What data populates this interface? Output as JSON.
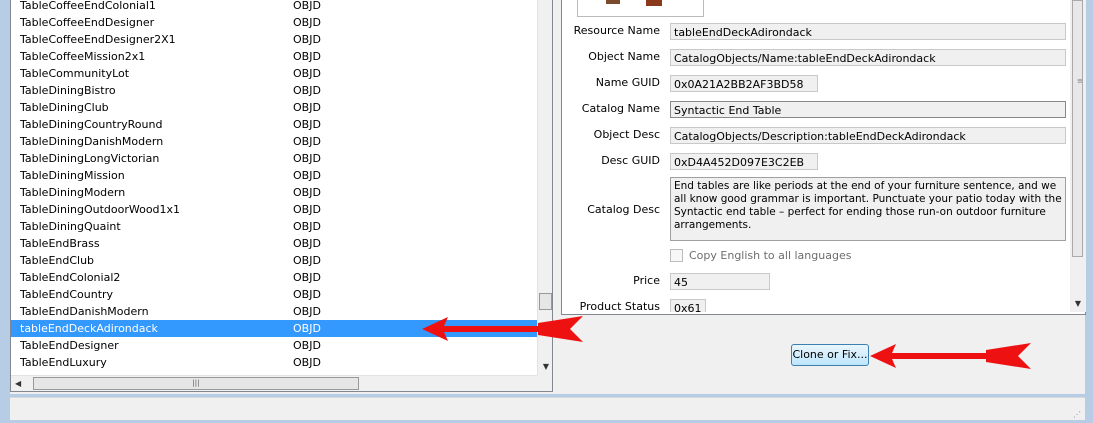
{
  "list": {
    "tag": "OBJD",
    "items": [
      "TableCoffeeEndColonial1",
      "TableCoffeeEndDesigner",
      "TableCoffeeEndDesigner2X1",
      "TableCoffeeMission2x1",
      "TableCommunityLot",
      "TableDiningBistro",
      "TableDiningClub",
      "TableDiningCountryRound",
      "TableDiningDanishModern",
      "TableDiningLongVictorian",
      "TableDiningMission",
      "TableDiningModern",
      "TableDiningOutdoorWood1x1",
      "TableDiningQuaint",
      "TableEndBrass",
      "TableEndClub",
      "TableEndColonial2",
      "TableEndCountry",
      "TableEndDanishModern",
      "tableEndDeckAdirondack",
      "TableEndDesigner",
      "TableEndLuxury"
    ],
    "selected_index": 19
  },
  "detail": {
    "resource_name_label": "Resource Name",
    "resource_name": "tableEndDeckAdirondack",
    "object_name_label": "Object Name",
    "object_name": "CatalogObjects/Name:tableEndDeckAdirondack",
    "name_guid_label": "Name GUID",
    "name_guid": "0x0A21A2BB2AF3BD58",
    "catalog_name_label": "Catalog Name",
    "catalog_name": "Syntactic End Table",
    "object_desc_label": "Object Desc",
    "object_desc": "CatalogObjects/Description:tableEndDeckAdirondack",
    "desc_guid_label": "Desc GUID",
    "desc_guid": "0xD4A452D097E3C2EB",
    "catalog_desc_label": "Catalog Desc",
    "catalog_desc": "End tables are like periods at the end of your furniture sentence, and we all know good grammar is important. Punctuate your patio today with the Syntactic end table – perfect for ending those run-on outdoor furniture arrangements.",
    "copy_english_label": "Copy English to all languages",
    "price_label": "Price",
    "price": "45",
    "product_status_label": "Product Status",
    "product_status": "0x61"
  },
  "buttons": {
    "clone_label": "Clone or Fix..."
  },
  "colors": {
    "selection": "#3399ff",
    "arrow": "#ee1111"
  }
}
